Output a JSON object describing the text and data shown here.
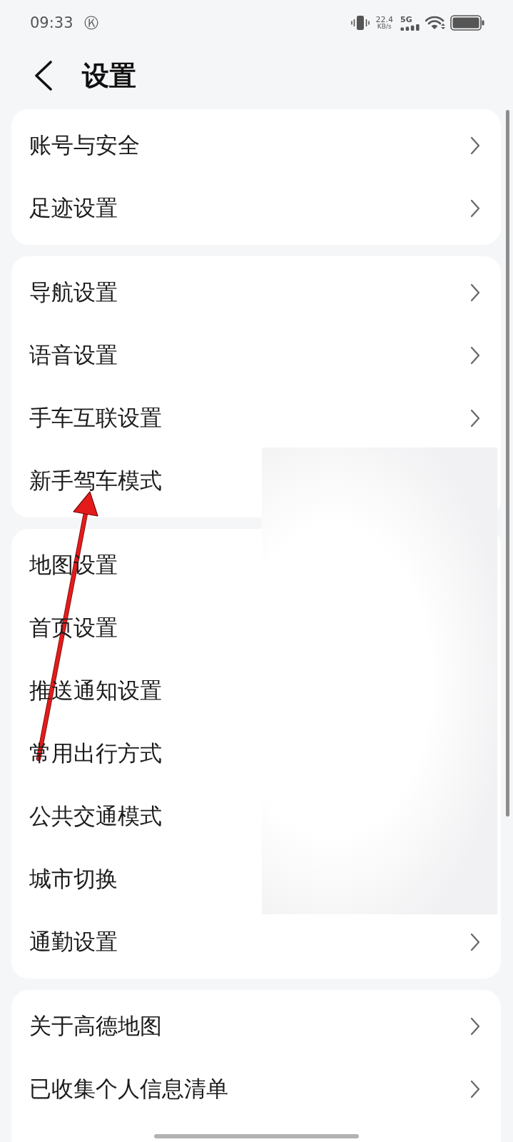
{
  "status_bar": {
    "time": "09:33",
    "notification_icon": "Ⓚ",
    "net_speed": "22.4",
    "net_speed_unit": "KB/s",
    "network_type": "5G"
  },
  "header": {
    "title": "设置"
  },
  "groups": [
    {
      "items": [
        {
          "label": "账号与安全",
          "chevron": true
        },
        {
          "label": "足迹设置",
          "chevron": true
        }
      ]
    },
    {
      "items": [
        {
          "label": "导航设置",
          "chevron": true
        },
        {
          "label": "语音设置",
          "chevron": true
        },
        {
          "label": "手车互联设置",
          "chevron": true
        },
        {
          "label": "新手驾车模式",
          "chevron": false
        }
      ]
    },
    {
      "items": [
        {
          "label": "地图设置",
          "chevron": false
        },
        {
          "label": "首页设置",
          "chevron": false
        },
        {
          "label": "推送通知设置",
          "chevron": false
        },
        {
          "label": "常用出行方式",
          "chevron": false
        },
        {
          "label": "公共交通模式",
          "chevron": false
        },
        {
          "label": "城市切换",
          "chevron": false
        },
        {
          "label": "通勤设置",
          "chevron": true
        }
      ]
    },
    {
      "items": [
        {
          "label": "关于高德地图",
          "chevron": true
        },
        {
          "label": "已收集个人信息清单",
          "chevron": true
        }
      ]
    }
  ]
}
